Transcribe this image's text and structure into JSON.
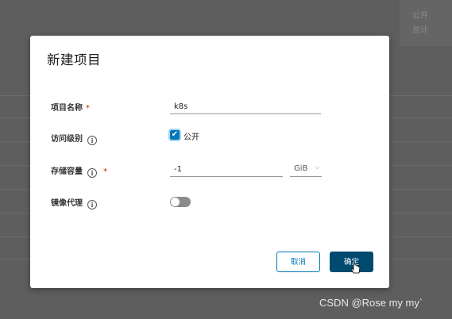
{
  "background": {
    "menu_items": [
      "公开",
      "总计"
    ]
  },
  "dialog": {
    "title": "新建项目",
    "fields": {
      "project_name": {
        "label": "项目名称",
        "required_mark": "*",
        "value": "k8s"
      },
      "access_level": {
        "label": "访问级别",
        "checkbox_checked": true,
        "checkbox_label": "公开"
      },
      "storage_quota": {
        "label": "存储容量",
        "required_mark": "*",
        "value": "-1",
        "unit": "GiB"
      },
      "proxy_cache": {
        "label": "镜像代理",
        "toggle_on": false
      }
    },
    "buttons": {
      "cancel": "取消",
      "confirm": "确定"
    }
  },
  "watermark": "CSDN @Rose my my`",
  "colors": {
    "primary": "#0079b8",
    "confirm_bg": "#004a70",
    "required": "#c92100",
    "overlay": "#5e5e5e"
  },
  "icons": [
    "info-icon",
    "check-icon",
    "chevron-down-icon",
    "cursor-icon"
  ]
}
